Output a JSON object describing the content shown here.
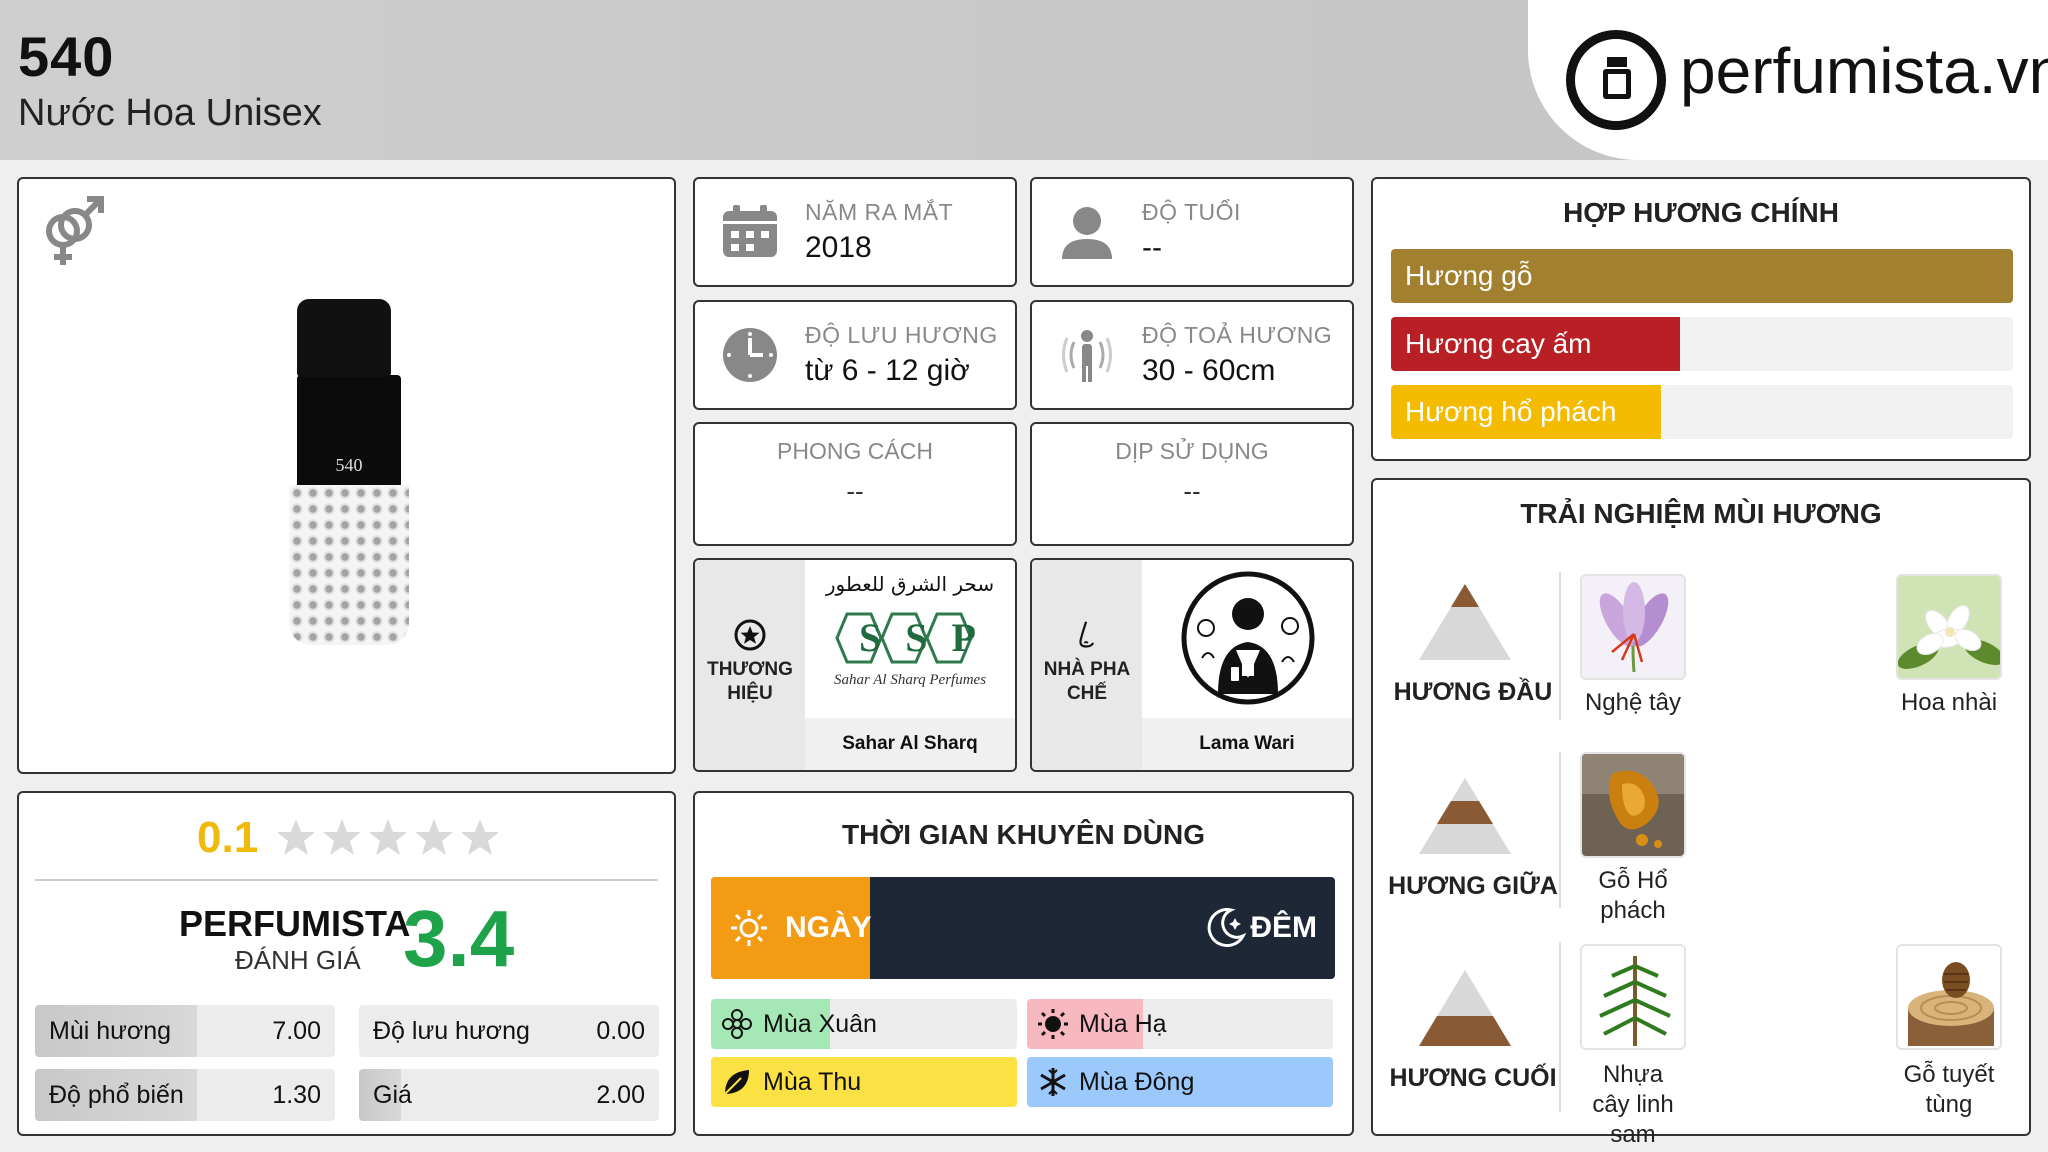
{
  "header": {
    "title": "540",
    "subtitle": "Nước Hoa Unisex",
    "logo_text": "perfumista.vn"
  },
  "product": {
    "bottle_label": "540",
    "gender_icon": "unisex-icon"
  },
  "info": {
    "release": {
      "label": "NĂM RA MẮT",
      "value": "2018",
      "icon": "calendar-icon"
    },
    "age": {
      "label": "ĐỘ TUỔI",
      "value": "--",
      "icon": "person-icon"
    },
    "longevity": {
      "label": "ĐỘ LƯU HƯƠNG",
      "value": "từ 6 - 12 giờ",
      "icon": "clock-icon"
    },
    "sillage": {
      "label": "ĐỘ TOẢ HƯƠNG",
      "value": "30 - 60cm",
      "icon": "sillage-icon"
    },
    "style": {
      "label": "PHONG CÁCH",
      "value": "--"
    },
    "occasion": {
      "label": "DỊP SỬ DỤNG",
      "value": "--"
    },
    "brand": {
      "side_label": "THƯƠNG HIỆU",
      "name": "Sahar Al Sharq Perfumes",
      "logo_arabic": "سحر الشرق للعطور",
      "logo_letters": "SSP",
      "logo_script": "Sahar Al Sharq Perfumes"
    },
    "perfumer": {
      "side_label": "NHÀ PHA CHẾ",
      "name": "Lama Wari"
    }
  },
  "accords": {
    "title": "HỢP HƯƠNG CHÍNH",
    "items": [
      {
        "label": "Hương gỗ",
        "value": 1.0,
        "color": "#a2802f"
      },
      {
        "label": "Hương cay ấm",
        "value": 0.464,
        "color": "#b82025"
      },
      {
        "label": "Hương hổ phách",
        "value": 0.434,
        "color": "#f5bb00"
      }
    ]
  },
  "notes": {
    "title": "TRẢI NGHIỆM MÙI HƯƠNG",
    "top": {
      "label": "HƯƠNG ĐẦU",
      "items": [
        "Nghệ tây",
        "Hoa nhài"
      ]
    },
    "middle": {
      "label": "HƯƠNG GIỮA",
      "items": [
        "Gỗ Hổ phách"
      ]
    },
    "base": {
      "label": "HƯƠNG CUỐI",
      "items": [
        "Nhựa cây linh sam",
        "Gỗ tuyết tùng"
      ]
    }
  },
  "rating": {
    "user_score": "0.1",
    "user_stars": 0.02,
    "pf_name": "PERFUMISTA",
    "pf_sub": "ĐÁNH GIÁ",
    "pf_score": "3.4",
    "metrics": [
      {
        "label": "Mùi hương",
        "value": "7.00",
        "fill": 0.54
      },
      {
        "label": "Độ lưu hương",
        "value": "0.00",
        "fill": 0.0
      },
      {
        "label": "Độ phổ biến",
        "value": "1.30",
        "fill": 0.54
      },
      {
        "label": "Giá",
        "value": "2.00",
        "fill": 0.14
      }
    ]
  },
  "time": {
    "title": "THỜI GIAN KHUYÊN DÙNG",
    "day_label": "NGÀY",
    "night_label": "ĐÊM",
    "day_fraction": 0.255,
    "seasons": [
      {
        "label": "Mùa Xuân",
        "fill": 0.39,
        "color": "#a6e8b5",
        "icon": "flower-icon"
      },
      {
        "label": "Mùa Hạ",
        "fill": 0.38,
        "color": "#f7b8c0",
        "icon": "sun-icon"
      },
      {
        "label": "Mùa Thu",
        "fill": 1.0,
        "color": "#fbe143",
        "icon": "leaf-icon"
      },
      {
        "label": "Mùa Đông",
        "fill": 1.0,
        "color": "#9cc9fb",
        "icon": "snowflake-icon"
      }
    ]
  }
}
